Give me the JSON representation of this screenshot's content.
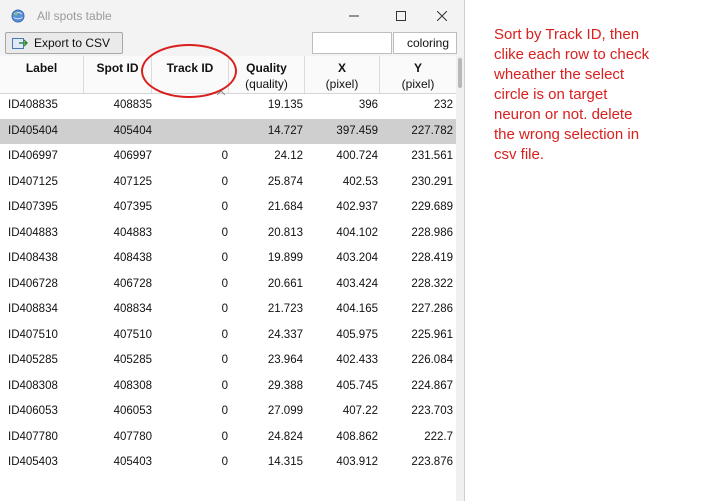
{
  "window": {
    "title": "All spots table"
  },
  "toolbar": {
    "export_label": "Export to CSV",
    "filter_value": "",
    "coloring_label": "coloring"
  },
  "columns": [
    {
      "name": "label",
      "title": "Label",
      "sub": ""
    },
    {
      "name": "spot-id",
      "title": "Spot ID",
      "sub": ""
    },
    {
      "name": "track-id",
      "title": "Track ID",
      "sub": ""
    },
    {
      "name": "quality",
      "title": "Quality",
      "sub": "(quality)"
    },
    {
      "name": "x",
      "title": "X",
      "sub": "(pixel)"
    },
    {
      "name": "y",
      "title": "Y",
      "sub": "(pixel)"
    }
  ],
  "rows": [
    {
      "label": "ID408835",
      "spot_id": "408835",
      "track_id": "",
      "quality": "19.135",
      "x": "396",
      "y": "232"
    },
    {
      "label": "ID405404",
      "spot_id": "405404",
      "track_id": "",
      "quality": "14.727",
      "x": "397.459",
      "y": "227.782"
    },
    {
      "label": "ID406997",
      "spot_id": "406997",
      "track_id": "0",
      "quality": "24.12",
      "x": "400.724",
      "y": "231.561"
    },
    {
      "label": "ID407125",
      "spot_id": "407125",
      "track_id": "0",
      "quality": "25.874",
      "x": "402.53",
      "y": "230.291"
    },
    {
      "label": "ID407395",
      "spot_id": "407395",
      "track_id": "0",
      "quality": "21.684",
      "x": "402.937",
      "y": "229.689"
    },
    {
      "label": "ID404883",
      "spot_id": "404883",
      "track_id": "0",
      "quality": "20.813",
      "x": "404.102",
      "y": "228.986"
    },
    {
      "label": "ID408438",
      "spot_id": "408438",
      "track_id": "0",
      "quality": "19.899",
      "x": "403.204",
      "y": "228.419"
    },
    {
      "label": "ID406728",
      "spot_id": "406728",
      "track_id": "0",
      "quality": "20.661",
      "x": "403.424",
      "y": "228.322"
    },
    {
      "label": "ID408834",
      "spot_id": "408834",
      "track_id": "0",
      "quality": "21.723",
      "x": "404.165",
      "y": "227.286"
    },
    {
      "label": "ID407510",
      "spot_id": "407510",
      "track_id": "0",
      "quality": "24.337",
      "x": "405.975",
      "y": "225.961"
    },
    {
      "label": "ID405285",
      "spot_id": "405285",
      "track_id": "0",
      "quality": "23.964",
      "x": "402.433",
      "y": "226.084"
    },
    {
      "label": "ID408308",
      "spot_id": "408308",
      "track_id": "0",
      "quality": "29.388",
      "x": "405.745",
      "y": "224.867"
    },
    {
      "label": "ID406053",
      "spot_id": "406053",
      "track_id": "0",
      "quality": "27.099",
      "x": "407.22",
      "y": "223.703"
    },
    {
      "label": "ID407780",
      "spot_id": "407780",
      "track_id": "0",
      "quality": "24.824",
      "x": "408.862",
      "y": "222.7"
    },
    {
      "label": "ID405403",
      "spot_id": "405403",
      "track_id": "0",
      "quality": "14.315",
      "x": "403.912",
      "y": "223.876"
    }
  ],
  "selected_row_index": 1,
  "annotation": {
    "lines": [
      "Sort by Track ID, then",
      "clike each row to check",
      "wheather the select",
      "circle is on target",
      "neuron or not. delete",
      "the wrong selection in",
      "csv file."
    ],
    "color": "#d8201e"
  },
  "icons": {
    "app": "app-globe-icon",
    "export": "export-csv-icon",
    "minimize": "minimize-icon",
    "maximize": "maximize-icon",
    "close": "close-icon",
    "sort": "sort-ascending-icon"
  }
}
